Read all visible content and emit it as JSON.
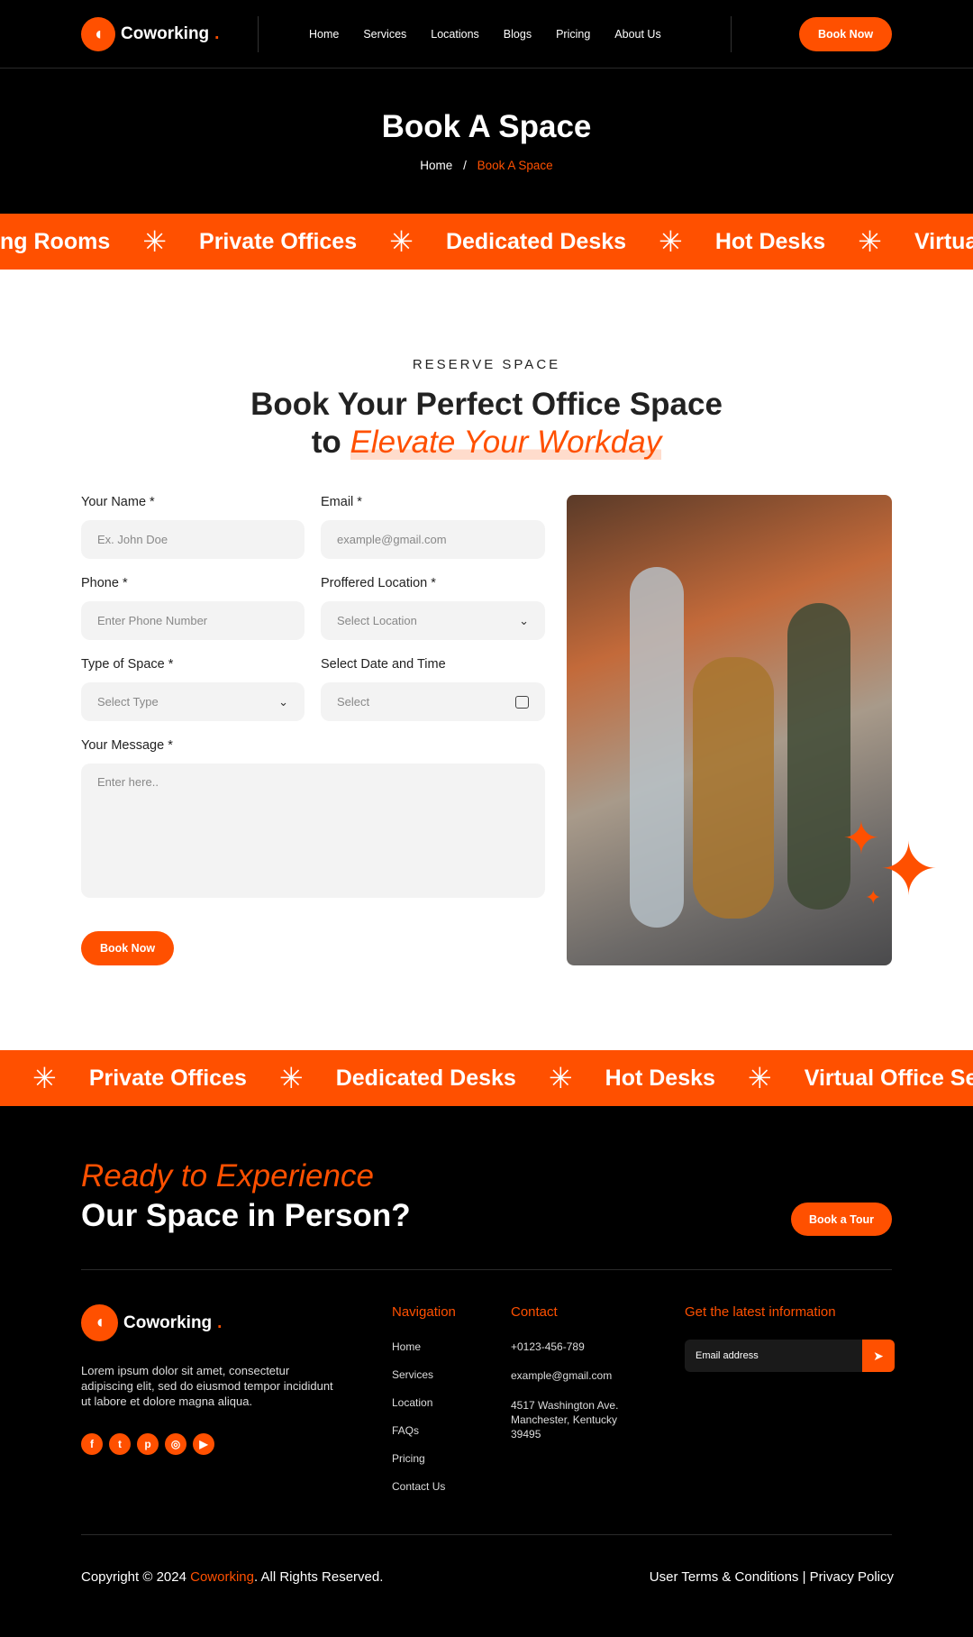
{
  "header": {
    "brand": "Coworking",
    "nav": [
      "Home",
      "Services",
      "Locations",
      "Blogs",
      "Pricing",
      "About Us"
    ],
    "cta": "Book Now"
  },
  "hero": {
    "title": "Book A Space",
    "breadcrumb": {
      "home": "Home",
      "sep": "/",
      "current": "Book A Space"
    }
  },
  "banner1": [
    "ng Rooms",
    "Private Offices",
    "Dedicated Desks",
    "Hot Desks",
    "Virtual O"
  ],
  "banner2": [
    "",
    "Private Offices",
    "Dedicated Desks",
    "Hot Desks",
    "Virtual Office Servi"
  ],
  "section": {
    "eyebrow": "RESERVE SPACE",
    "heading_line1": "Book Your Perfect Office Space",
    "heading_to": "to",
    "heading_accent": "Elevate Your Workday"
  },
  "form": {
    "name": {
      "label": "Your Name *",
      "placeholder": "Ex. John Doe"
    },
    "email": {
      "label": "Email *",
      "placeholder": "example@gmail.com"
    },
    "phone": {
      "label": "Phone *",
      "placeholder": "Enter Phone Number"
    },
    "location": {
      "label": "Proffered Location *",
      "placeholder": "Select Location"
    },
    "type": {
      "label": "Type of Space *",
      "placeholder": "Select Type"
    },
    "datetime": {
      "label": "Select Date and Time",
      "placeholder": "Select"
    },
    "message": {
      "label": "Your Message *",
      "placeholder": "Enter here.."
    },
    "submit": "Book Now"
  },
  "cta": {
    "line1": "Ready to Experience",
    "line2": "Our Space in Person?",
    "button": "Book a Tour"
  },
  "footer": {
    "brand": "Coworking",
    "about": "Lorem ipsum dolor sit amet, consectetur adipiscing elit, sed do eiusmod tempor incididunt ut labore et dolore magna aliqua.",
    "social": [
      "facebook-icon",
      "twitter-icon",
      "pinterest-icon",
      "instagram-icon",
      "youtube-icon"
    ],
    "nav_title": "Navigation",
    "nav": [
      "Home",
      "Services",
      "Location",
      "FAQs",
      "Pricing",
      "Contact Us"
    ],
    "contact_title": "Contact",
    "phone": "+0123-456-789",
    "email": "example@gmail.com",
    "address": "4517 Washington Ave. Manchester, Kentucky 39495",
    "news_title": "Get the latest information",
    "news_placeholder": "Email address",
    "copy_pre": "Copyright © 2024 ",
    "copy_brand": "Coworking",
    "copy_post": ". All Rights Reserved.",
    "terms": "User Terms & Conditions | Privacy Policy"
  },
  "colors": {
    "accent": "#ff5000",
    "dark": "#000000",
    "field": "#f3f3f3"
  }
}
